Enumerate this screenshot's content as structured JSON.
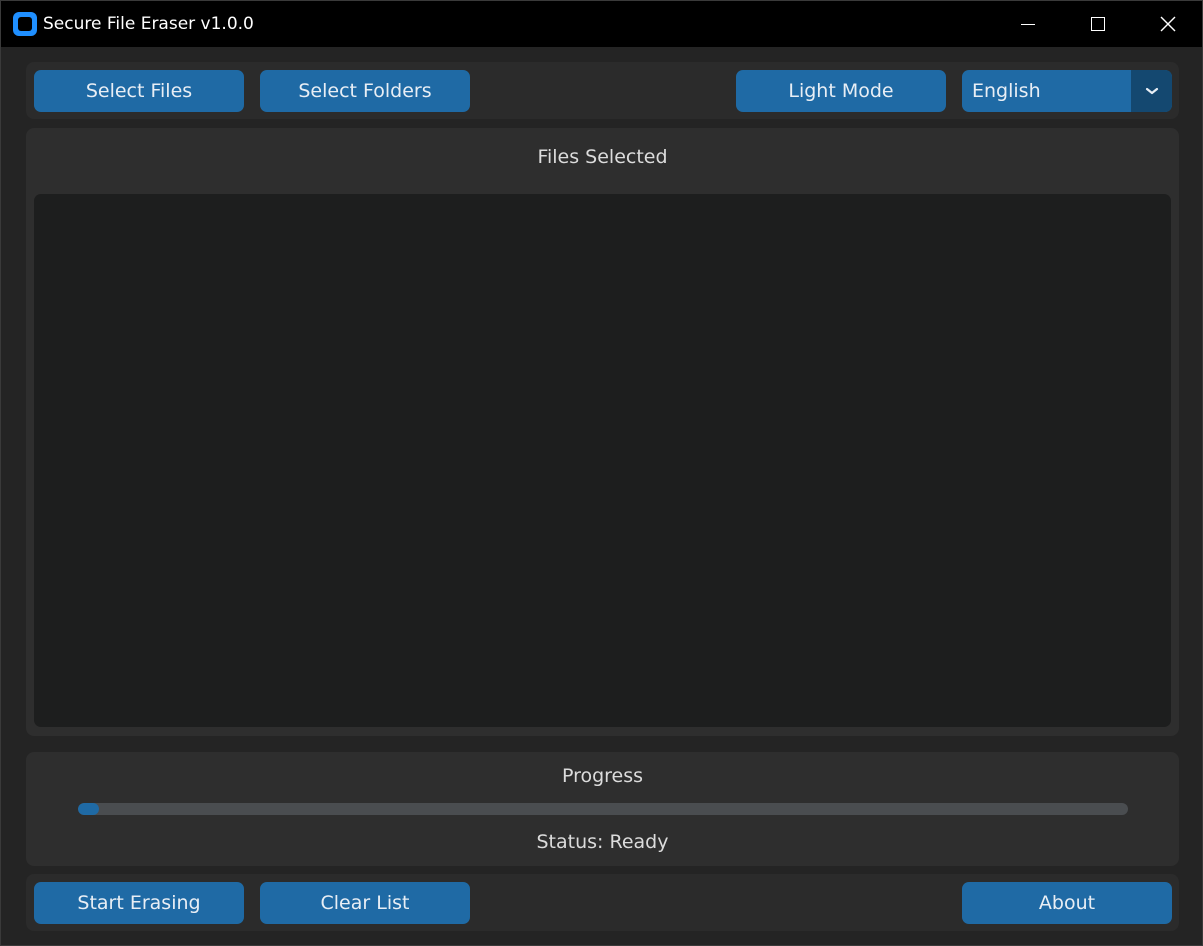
{
  "window": {
    "title": "Secure File Eraser v1.0.0",
    "controls": {
      "minimize": "minimize-icon",
      "maximize": "maximize-icon",
      "close": "close-icon"
    }
  },
  "toolbar": {
    "select_files": "Select Files",
    "select_folders": "Select Folders",
    "theme_toggle": "Light Mode",
    "language": {
      "selected": "English"
    }
  },
  "files": {
    "title": "Files Selected",
    "items": []
  },
  "progress": {
    "title": "Progress",
    "fraction": 0.02,
    "status": "Status: Ready"
  },
  "actions": {
    "start_erasing": "Start Erasing",
    "clear_list": "Clear List",
    "about": "About"
  },
  "colors": {
    "accent": "#1f6aa5",
    "accent_dark": "#144870",
    "titlebar": "#000000",
    "background": "#242424",
    "frame": "#2e2e2e",
    "list_background": "#1d1e1e"
  }
}
